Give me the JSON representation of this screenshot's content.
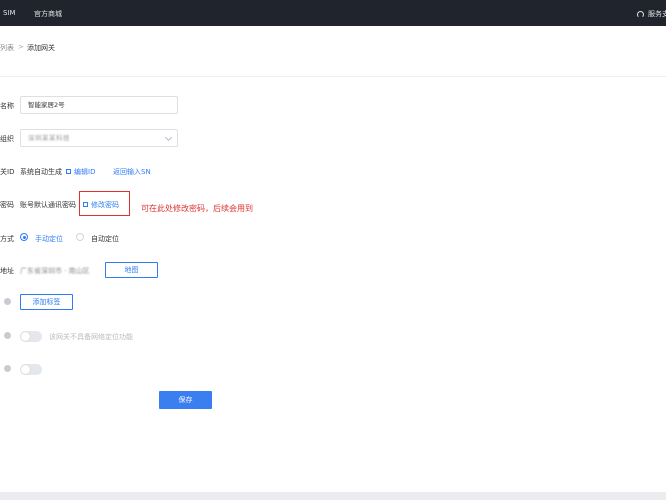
{
  "topbar": {
    "nav_sim": "SIM",
    "nav_store": "官方商城",
    "service_label": "服务支"
  },
  "breadcrumb": {
    "parent": "列表",
    "separator": ">",
    "current": "添加网关"
  },
  "form": {
    "name": {
      "label": "名称",
      "value": "智能家居2号"
    },
    "org": {
      "label": "组织",
      "value": "深圳某某科技"
    },
    "gateway_id": {
      "label": "关ID",
      "value": "系统自动生成",
      "edit_link": "编辑ID",
      "sn_link": "返回输入SN"
    },
    "password": {
      "label": "密码",
      "value": "账号默认通讯密码",
      "edit_link": "修改密码",
      "annotation": "可在此处修改密码，后续会用到"
    },
    "location_mode": {
      "label": "方式",
      "options": [
        "手动定位",
        "自动定位"
      ],
      "selected": "手动定位"
    },
    "address": {
      "label": "地址",
      "value": "广东省深圳市 · 南山区",
      "map_button": "地图"
    },
    "tags": {
      "add_button": "添加标签"
    },
    "positioning": {
      "hint": "该网关不具备网络定位功能",
      "enabled": false
    },
    "extra_switch": {
      "enabled": false
    },
    "save_button": "保存"
  },
  "colors": {
    "topbar": "#20242c",
    "accent": "#2f7cf6",
    "primary_button": "#3a7ef2",
    "annotation": "#e0312f"
  }
}
